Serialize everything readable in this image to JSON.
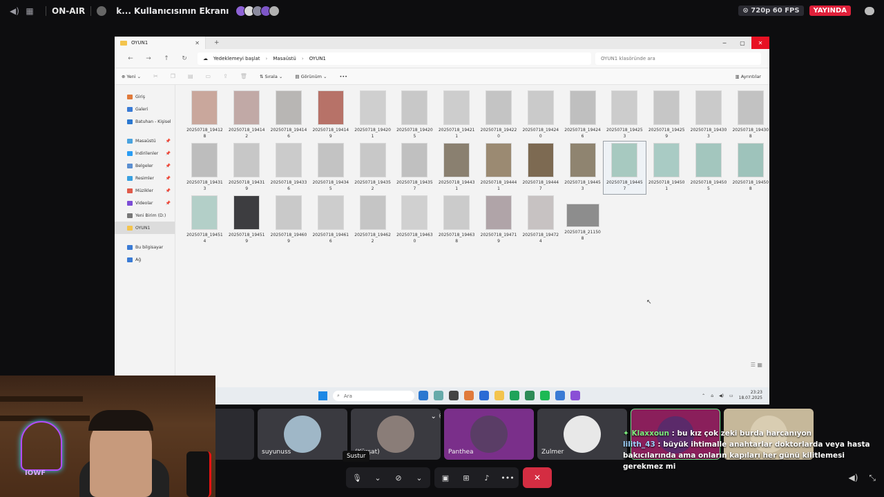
{
  "topbar": {
    "on_air": "ON-AIR",
    "stream_title": "k... Kullanıcısının Ekranı",
    "quality": "720p 60 FPS",
    "live_label": "YAYINDA",
    "avatar_colors": [
      "#8e63d6",
      "#d9d9d9",
      "#8a8a9e",
      "#7d56c8",
      "#b1b1b1"
    ]
  },
  "explorer": {
    "tab_title": "OYUN1",
    "breadcrumbs": [
      "Yedeklemeyi başlat",
      "Masaüstü",
      "OYUN1"
    ],
    "search_placeholder": "OYUN1 klasöründe ara",
    "toolbar": {
      "new": "Yeni",
      "sort": "Sırala",
      "view": "Görünüm",
      "more": "•••",
      "details": "Ayrıntılar"
    },
    "nav": [
      {
        "label": "Giriş",
        "color": "#e07a3b"
      },
      {
        "label": "Galeri",
        "color": "#3a7bd5"
      },
      {
        "label": "Batuhan - Kişisel",
        "color": "#2b78d0"
      },
      {
        "label": "Masaüstü",
        "color": "#4aa3df",
        "pin": true
      },
      {
        "label": "İndirilenler",
        "color": "#2a9df4",
        "pin": true
      },
      {
        "label": "Belgeler",
        "color": "#5b8fd1",
        "pin": true
      },
      {
        "label": "Resimler",
        "color": "#39a0e0",
        "pin": true
      },
      {
        "label": "Müzikler",
        "color": "#e05a4a",
        "pin": true
      },
      {
        "label": "Videolar",
        "color": "#7c4dd6",
        "pin": true
      },
      {
        "label": "Yeni Birim (D:)",
        "color": "#777"
      },
      {
        "label": "OYUN1",
        "color": "#f3c44d"
      },
      {
        "label": "Bu bilgisayar",
        "color": "#3a7bd5"
      },
      {
        "label": "Ağ",
        "color": "#3a7bd5"
      }
    ],
    "files": [
      {
        "l1": "20250718_19412",
        "l2": "8",
        "c": "#c9a79c"
      },
      {
        "l1": "20250718_19414",
        "l2": "2",
        "c": "#c1a9a6"
      },
      {
        "l1": "20250718_19414",
        "l2": "6",
        "c": "#b8b6b4"
      },
      {
        "l1": "20250718_19414",
        "l2": "9",
        "c": "#b77268"
      },
      {
        "l1": "20250718_19420",
        "l2": "1",
        "c": "#cfcfcf"
      },
      {
        "l1": "20250718_19420",
        "l2": "5",
        "c": "#c8c8c8"
      },
      {
        "l1": "20250718_19421",
        "l2": "1",
        "c": "#cdcdcd"
      },
      {
        "l1": "20250718_19422",
        "l2": "0",
        "c": "#c4c4c4"
      },
      {
        "l1": "20250718_19424",
        "l2": "0",
        "c": "#cacaca"
      },
      {
        "l1": "20250718_19424",
        "l2": "6",
        "c": "#bfbfbf"
      },
      {
        "l1": "20250718_19425",
        "l2": "3",
        "c": "#cccccc"
      },
      {
        "l1": "20250718_19425",
        "l2": "9",
        "c": "#c6c6c6"
      },
      {
        "l1": "20250718_19430",
        "l2": "3",
        "c": "#cacaca"
      },
      {
        "l1": "20250718_19430",
        "l2": "8",
        "c": "#c2c2c2"
      },
      {
        "l1": "20250718_19431",
        "l2": "3",
        "c": "#bdbdbd"
      },
      {
        "l1": "20250718_19431",
        "l2": "9",
        "c": "#c7c7c7"
      },
      {
        "l1": "20250718_19433",
        "l2": "6",
        "c": "#cbcbcb"
      },
      {
        "l1": "20250718_19434",
        "l2": "5",
        "c": "#c3c3c3"
      },
      {
        "l1": "20250718_19435",
        "l2": "2",
        "c": "#c8c8c8"
      },
      {
        "l1": "20250718_19435",
        "l2": "7",
        "c": "#c0c0c0"
      },
      {
        "l1": "20250718_19443",
        "l2": "1",
        "c": "#8a8070"
      },
      {
        "l1": "20250718_19444",
        "l2": "1",
        "c": "#9b8a72"
      },
      {
        "l1": "20250718_19444",
        "l2": "7",
        "c": "#7d6a52"
      },
      {
        "l1": "20250718_19445",
        "l2": "3",
        "c": "#8f8470"
      },
      {
        "l1": "20250718_19445",
        "l2": "7",
        "c": "#a7c9c0",
        "sel": true
      },
      {
        "l1": "20250718_19450",
        "l2": "1",
        "c": "#a9cbc4"
      },
      {
        "l1": "20250718_19450",
        "l2": "5",
        "c": "#a3c6be"
      },
      {
        "l1": "20250718_19450",
        "l2": "8",
        "c": "#9ec3bb"
      },
      {
        "l1": "20250718_19451",
        "l2": "4",
        "c": "#b3cfc8"
      },
      {
        "l1": "20250718_19451",
        "l2": "9",
        "c": "#3d3d40"
      },
      {
        "l1": "20250718_19460",
        "l2": "9",
        "c": "#c9c9c9"
      },
      {
        "l1": "20250718_19461",
        "l2": "6",
        "c": "#cdcdcd"
      },
      {
        "l1": "20250718_19462",
        "l2": "2",
        "c": "#c5c5c5"
      },
      {
        "l1": "20250718_19463",
        "l2": "0",
        "c": "#d0d0d0"
      },
      {
        "l1": "20250718_19463",
        "l2": "8",
        "c": "#cbcbcb"
      },
      {
        "l1": "20250718_19471",
        "l2": "9",
        "c": "#b0a4a8"
      },
      {
        "l1": "20250718_19472",
        "l2": "4",
        "c": "#c7c2c2"
      },
      {
        "l1": "20250718_21150",
        "l2": "8",
        "c": "#8d8d8d",
        "wide": true
      }
    ],
    "taskbar": {
      "search_placeholder": "Ara",
      "time": "23:23",
      "date": "18.07.2025",
      "app_colors": [
        "#2b78d0",
        "#6aa",
        "#444",
        "#e07a3b",
        "#2a6bd5",
        "#f3c44d",
        "#1fa35a",
        "#2e8b57",
        "#1db954",
        "#3a7bd5",
        "#8a4fd6"
      ]
    }
  },
  "participants": [
    {
      "name": "",
      "color": "#55555b"
    },
    {
      "name": "suyunuss",
      "color": "#9fb7c7"
    },
    {
      "name": "(Kürşat)",
      "color": "#8a7d78"
    },
    {
      "name": "Panthea",
      "color": "#5a3d66"
    },
    {
      "name": "Zulmer",
      "color": "#e8e8e8"
    },
    {
      "name": "",
      "color": "#5b2a6a"
    },
    {
      "name": "",
      "color": "#d9cdb2"
    }
  ],
  "webcam": {
    "logo_text": "IOWF"
  },
  "controls": {
    "tooltip": "Sustur"
  },
  "chat": [
    {
      "user": "Klaxxoun",
      "prefix": "✦ ",
      "text": " : bu kız çok zeki burda harcanıyon"
    },
    {
      "user": "lilith_43",
      "prefix": "",
      "text": " : büyük ihtimalle anahtarlar doktorlarda veya hasta bakıcılarında ama onların kapıları her günü kilitlemesi gerekmez mi"
    }
  ]
}
